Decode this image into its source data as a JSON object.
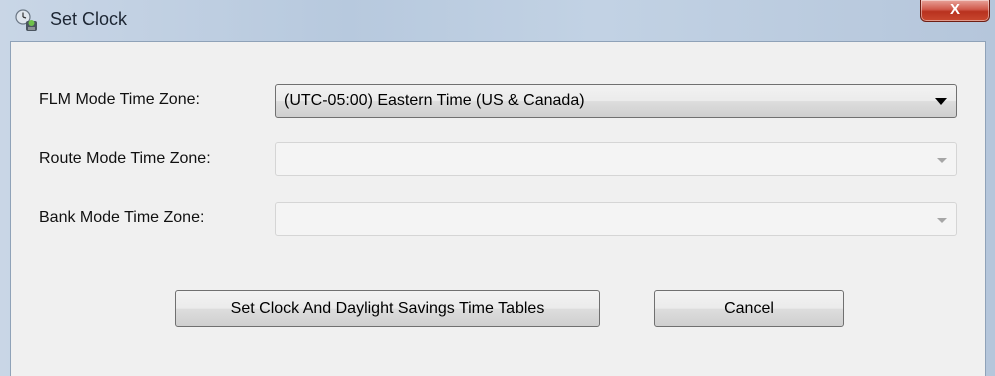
{
  "window": {
    "title": "Set Clock",
    "close_glyph": "X",
    "icon": "clock-app-icon"
  },
  "form": {
    "flm_label": "FLM Mode Time Zone:",
    "flm_value": "(UTC-05:00) Eastern Time (US & Canada)",
    "route_label": "Route Mode Time Zone:",
    "route_value": "",
    "bank_label": "Bank Mode Time Zone:",
    "bank_value": ""
  },
  "buttons": {
    "set_clock": "Set Clock And Daylight Savings Time Tables",
    "cancel": "Cancel"
  },
  "colors": {
    "titlebar": "#b7c9de",
    "close": "#c9482f",
    "client": "#f0f0f0"
  }
}
